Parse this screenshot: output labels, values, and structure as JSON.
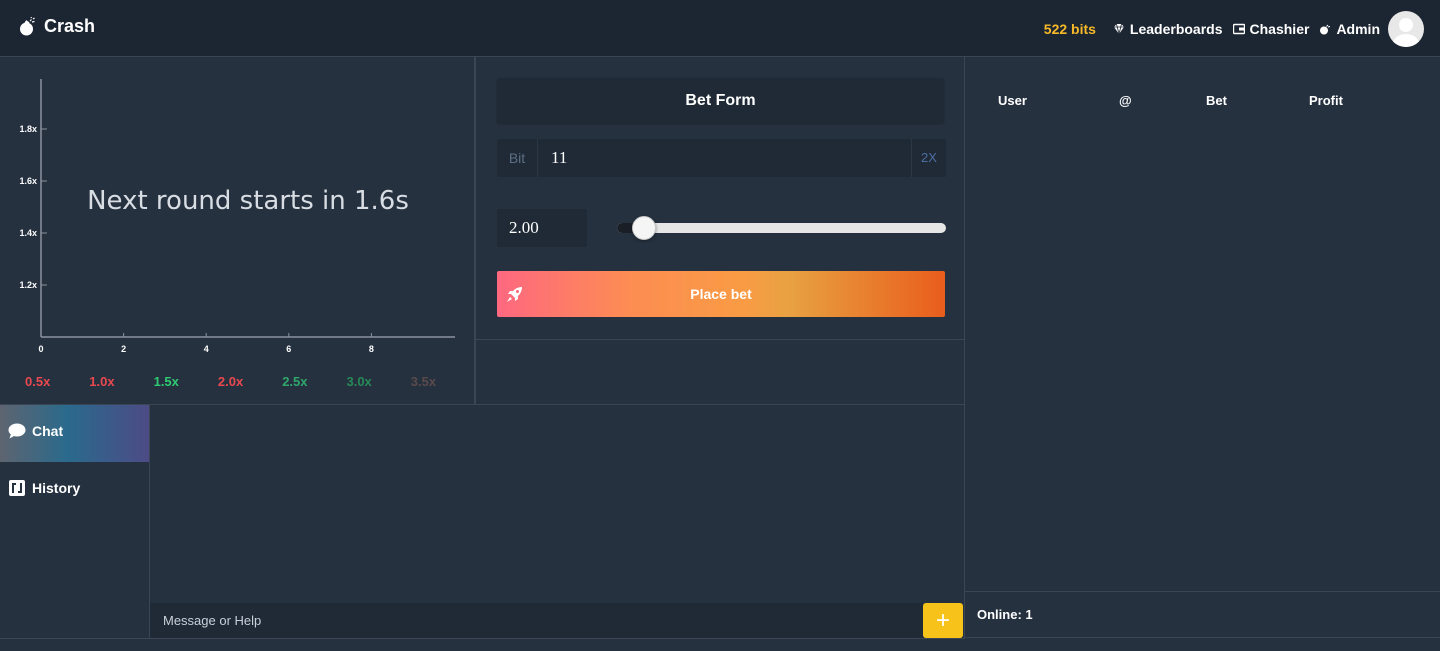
{
  "brand": {
    "name": "Crash",
    "icon": "bomb-icon"
  },
  "nav": {
    "bits": "522 bits",
    "leaderboards": "Leaderboards",
    "cashier": "Chashier",
    "admin": "Admin"
  },
  "graph": {
    "countdown": "Next round starts in 1.6s",
    "y_ticks": [
      "1.2x",
      "1.4x",
      "1.6x",
      "1.8x"
    ],
    "x_ticks": [
      "0",
      "2",
      "4",
      "6",
      "8"
    ]
  },
  "multipliers": [
    {
      "label": "0.5x",
      "color": "#e8494f"
    },
    {
      "label": "1.0x",
      "color": "#e8494f"
    },
    {
      "label": "1.5x",
      "color": "#2ecc71"
    },
    {
      "label": "2.0x",
      "color": "#e8494f"
    },
    {
      "label": "2.5x",
      "color": "#2ea86a"
    },
    {
      "label": "3.0x",
      "color": "#268a57"
    },
    {
      "label": "3.5x",
      "color": "#5a4a4a"
    }
  ],
  "bet_form": {
    "title": "Bet Form",
    "amount_prefix": "Bit",
    "amount_value": "11",
    "double_label": "2X",
    "payout_value": "2.00",
    "slider_fraction": 0.04,
    "place_bet": "Place bet"
  },
  "players": {
    "columns": {
      "user": "User",
      "at": "@",
      "bet": "Bet",
      "profit": "Profit"
    },
    "online": "Online: 1"
  },
  "tabs": {
    "chat": "Chat",
    "history": "History"
  },
  "chat": {
    "placeholder": "Message or Help",
    "send": "+"
  }
}
